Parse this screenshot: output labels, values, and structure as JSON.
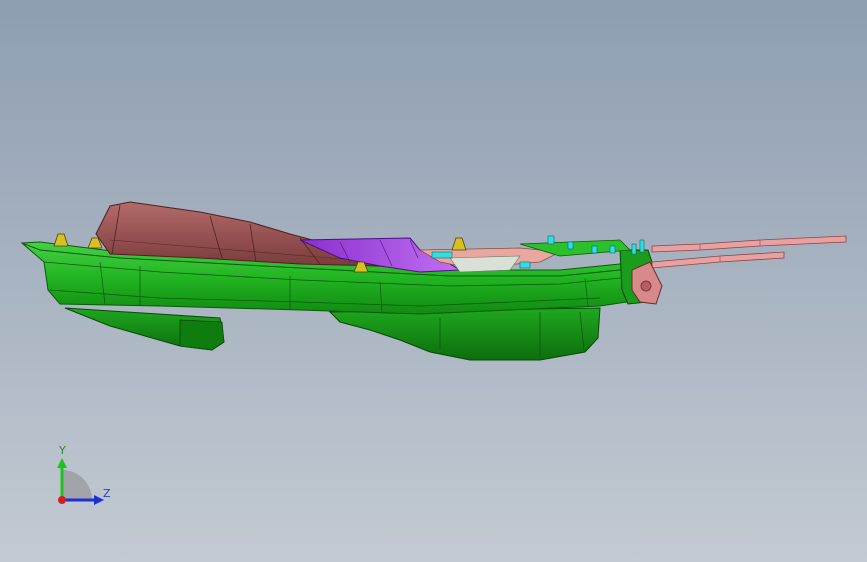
{
  "viewport": {
    "background_top": "#8e9db1",
    "background_bottom": "#c3cad2"
  },
  "model": {
    "colors": {
      "housing": "#22b422",
      "housing_dark": "#118a11",
      "housing_light": "#46d046",
      "cover": "#a05858",
      "cover_dark": "#6e3434",
      "inner_part": "#a040e0",
      "pink_blade": "#e8a0a0",
      "cyan_detail": "#30e0e0",
      "clip": "#d8c020"
    }
  },
  "triad": {
    "y_label": "Y",
    "z_label": "Z",
    "colors": {
      "y_axis": "#22c022",
      "z_axis": "#2030d0",
      "x_axis": "#d02020",
      "plane": "#8a8a8a"
    }
  }
}
